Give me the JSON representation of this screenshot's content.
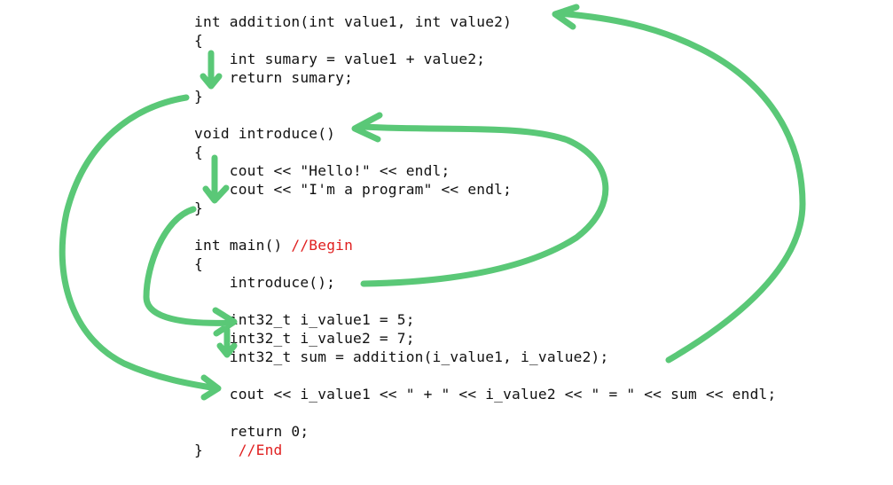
{
  "code_lines": [
    {
      "text": "int addition(int value1, int value2)",
      "comment": ""
    },
    {
      "text": "{",
      "comment": ""
    },
    {
      "text": "    int sumary = value1 + value2;",
      "comment": ""
    },
    {
      "text": "    return sumary;",
      "comment": ""
    },
    {
      "text": "}",
      "comment": ""
    },
    {
      "text": "",
      "comment": ""
    },
    {
      "text": "void introduce()",
      "comment": ""
    },
    {
      "text": "{",
      "comment": ""
    },
    {
      "text": "    cout << \"Hello!\" << endl;",
      "comment": ""
    },
    {
      "text": "    cout << \"I'm a program\" << endl;",
      "comment": ""
    },
    {
      "text": "}",
      "comment": ""
    },
    {
      "text": "",
      "comment": ""
    },
    {
      "text": "int main() ",
      "comment": "//Begin"
    },
    {
      "text": "{",
      "comment": ""
    },
    {
      "text": "    introduce();",
      "comment": ""
    },
    {
      "text": "",
      "comment": ""
    },
    {
      "text": "    int32_t i_value1 = 5;",
      "comment": ""
    },
    {
      "text": "    int32_t i_value2 = 7;",
      "comment": ""
    },
    {
      "text": "    int32_t sum = addition(i_value1, i_value2);",
      "comment": ""
    },
    {
      "text": "",
      "comment": ""
    },
    {
      "text": "    cout << i_value1 << \" + \" << i_value2 << \" = \" << sum << endl;",
      "comment": ""
    },
    {
      "text": "",
      "comment": ""
    },
    {
      "text": "    return 0;",
      "comment": ""
    },
    {
      "text": "}    ",
      "comment": "//End"
    }
  ],
  "colors": {
    "code_text": "#111111",
    "comment": "#e02020",
    "arrow": "#5ac877",
    "background": "#ffffff"
  },
  "arrows": [
    {
      "name": "arrow-addition-body-down",
      "meaning": "execution flows down through addition()"
    },
    {
      "name": "arrow-introduce-body-down",
      "meaning": "execution flows down through introduce()"
    },
    {
      "name": "arrow-call-introduce",
      "meaning": "introduce(); jumps to void introduce()"
    },
    {
      "name": "arrow-return-from-introduce",
      "meaning": "end of introduce() returns to int32_t i_value1"
    },
    {
      "name": "arrow-main-down",
      "meaning": "execution flows down through main() declarations"
    },
    {
      "name": "arrow-call-addition",
      "meaning": "addition(...) call jumps to int addition()"
    },
    {
      "name": "arrow-return-from-addition",
      "meaning": "end of addition() returns to cout line"
    }
  ]
}
